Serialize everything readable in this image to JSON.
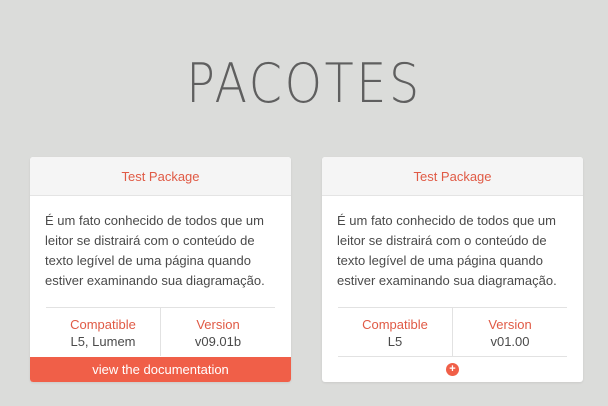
{
  "page": {
    "title": "PACOTES"
  },
  "packages": [
    {
      "name": "Test Package",
      "description": "É um fato conhecido de todos que um leitor se distrairá com o conteúdo de texto legível de uma página quando estiver examinando sua diagramação.",
      "compatible_label": "Compatible",
      "compatible_value": "L5, Lumem",
      "version_label": "Version",
      "version_value": "v09.01b",
      "doc_button_label": "view the documentation"
    },
    {
      "name": "Test Package",
      "description": "É um fato conhecido de todos que um leitor se distrairá com o conteúdo de texto legível de uma página quando estiver examinando sua diagramação.",
      "compatible_label": "Compatible",
      "compatible_value": "L5",
      "version_label": "Version",
      "version_value": "v01.00",
      "expand_icon": "+"
    }
  ],
  "colors": {
    "accent": "#f05f48",
    "accent_text": "#e05a45",
    "background": "#dbdcda",
    "title": "#5f5f5f"
  },
  "icons": {
    "expand": "plus-circle-icon"
  }
}
